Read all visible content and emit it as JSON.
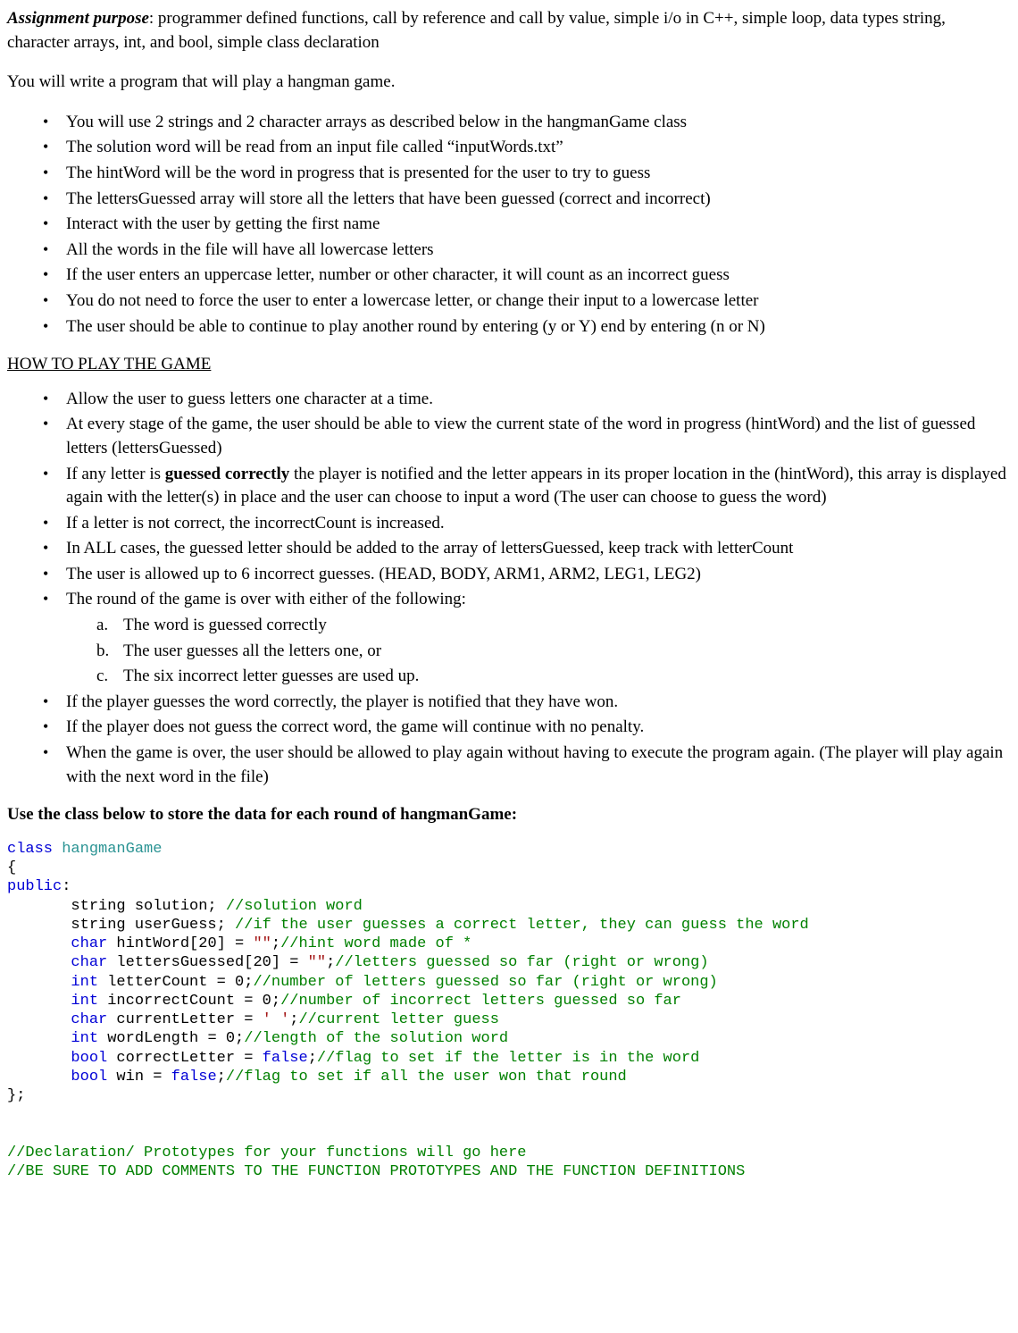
{
  "intro": {
    "label": "Assignment purpose",
    "text": ": programmer defined functions, call by reference and call by value, simple i/o in C++, simple loop, data types string, character arrays, int, and bool, simple class declaration"
  },
  "lead": "You will write a program that will play a hangman game.",
  "list1": {
    "items": [
      {
        "text": "You will use 2 strings and 2 character arrays as described below in the hangmanGame class"
      },
      {
        "prefix": "The ",
        "colored": "solution word",
        "suffix": "  will be read from an input file called “inputWords.txt”"
      },
      {
        "text": "The hintWord will be the word in progress that is presented for the user to try to guess"
      },
      {
        "text": "The lettersGuessed array will store all the letters that have been guessed (correct and incorrect)"
      },
      {
        "text": "Interact with the user by getting the first name"
      },
      {
        "text": "All the words in the file will have all lowercase letters"
      },
      {
        "text": "If the user enters an uppercase letter,  number or other character, it will count as an incorrect guess"
      },
      {
        "text": "You do not need to force the user to enter a lowercase letter, or change their input to a lowercase letter"
      },
      {
        "text": "The user should be able to continue to play another round by entering (y or Y) end by entering (n or N)"
      }
    ]
  },
  "section_title": "HOW TO PLAY THE GAME",
  "list2": {
    "items": [
      "Allow the user to guess letters one character at a time.",
      "At every stage of the game, the user should be able to view the current state of the word in progress (hintWord) and the list of guessed letters (lettersGuessed)"
    ],
    "item_bold": {
      "pre": "If any letter is ",
      "bold": "guessed correctly",
      "post": " the player is notified and the letter appears in its proper location in the (hintWord), this array is displayed again with the letter(s) in place and the user can choose to input a word (The user can choose to guess the word)"
    },
    "items2": [
      "If a letter is not correct, the incorrectCount is increased.",
      "In ALL cases, the guessed letter should be added to the array of lettersGuessed, keep track with letterCount",
      "The user is allowed up to 6 incorrect guesses. (HEAD,  BODY,  ARM1,  ARM2,  LEG1, LEG2)"
    ],
    "round_over": "The round of the game is over with either of the following:",
    "sub": [
      {
        "m": "a.",
        "t": "The word is guessed correctly"
      },
      {
        "m": "b.",
        "t": "The user guesses all the letters one, or"
      },
      {
        "m": "c.",
        "t": "The six incorrect letter guesses are used up."
      }
    ],
    "items3": [
      "If the player guesses the word correctly, the player is notified that they have won.",
      "If the player does not guess the correct word, the game will continue with no penalty.",
      "When the game is over, the user should be allowed to play again without having to execute the program again. (The player will play again with the next word in the file)"
    ]
  },
  "use_class": "Use the class  below to store the data for each round of hangmanGame:",
  "code": {
    "l1_kw": "class",
    "l1_name": " hangmanGame",
    "l2": "{",
    "l3_kw": "public",
    "l3_colon": ":",
    "l4_pre": "       string solution; ",
    "l4_cm": "//solution word",
    "l5_pre": "       string userGuess; ",
    "l5_cm": "//if the user guesses a correct letter, they can guess the word",
    "l6_kw": "char",
    "l6_mid": " hintWord[20] = ",
    "l6_str": "\"\"",
    "l6_semi": ";",
    "l6_cm": "//hint word made of *",
    "l7_kw": "char",
    "l7_mid": " lettersGuessed[20] = ",
    "l7_str": "\"\"",
    "l7_semi": ";",
    "l7_cm": "//letters guessed so far (right or wrong)",
    "l8_kw": "int",
    "l8_mid": " letterCount = 0;",
    "l8_cm": "//number of letters guessed so far (right or wrong)",
    "l9_kw": "int",
    "l9_mid": " incorrectCount = 0;",
    "l9_cm": "//number of incorrect letters guessed so far",
    "l10_kw": "char",
    "l10_mid": " currentLetter = ",
    "l10_str": "' '",
    "l10_semi": ";",
    "l10_cm": "//current letter guess",
    "l11_kw": "int",
    "l11_mid": " wordLength = 0;",
    "l11_cm": "//length of the solution word",
    "l12_kw": "bool",
    "l12_mid": " correctLetter = ",
    "l12_kw2": "false",
    "l12_semi": ";",
    "l12_cm": "//flag to set if the letter is in the word",
    "l13_kw": "bool",
    "l13_mid": " win = ",
    "l13_kw2": "false",
    "l13_semi": ";",
    "l13_cm": "//flag to set if all the user won that round",
    "l14": "};",
    "cm1": "//Declaration/ Prototypes for your functions will go here",
    "cm2": "//BE SURE TO ADD COMMENTS TO THE FUNCTION PROTOTYPES AND THE FUNCTION DEFINITIONS"
  }
}
